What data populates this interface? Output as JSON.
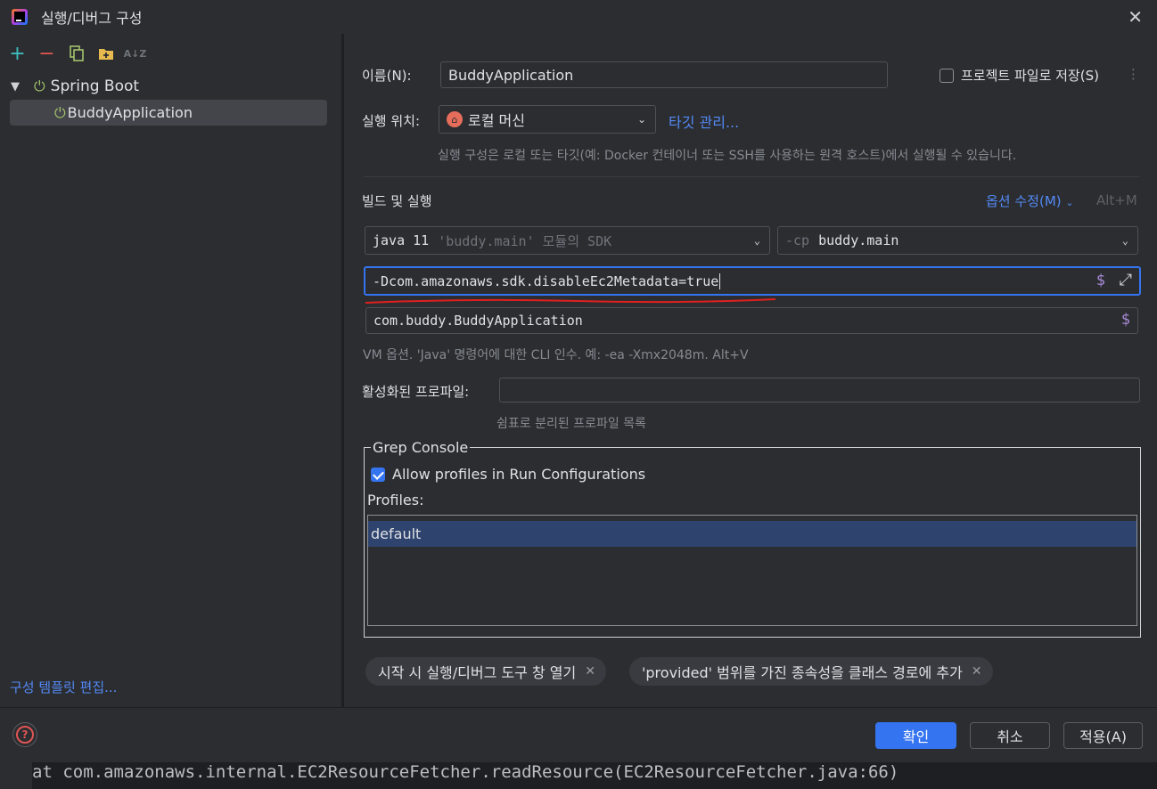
{
  "window": {
    "title": "실행/디버그 구성"
  },
  "left": {
    "tree": {
      "parent_label": "Spring Boot",
      "child_label": "BuddyApplication"
    },
    "edit_templates": "구성 템플릿 편집..."
  },
  "form": {
    "name_label": "이름(N):",
    "name_value": "BuddyApplication",
    "save_to_project": "프로젝트 파일로 저장(S)",
    "run_on_label": "실행 위치:",
    "run_on_value": "로컬 머신",
    "manage_targets": "타깃 관리...",
    "run_on_hint": "실행 구성은 로컬 또는 타깃(예: Docker 컨테이너 또는 SSH를 사용하는 원격 호스트)에서 실행될 수 있습니다.",
    "build_run_title": "빌드 및 실행",
    "modify_options": "옵션 수정(M)",
    "modify_shortcut": "Alt+M",
    "jdk_main": "java 11",
    "jdk_dim": "'buddy.main' 모듈의 SDK",
    "cp_prefix": "-cp",
    "cp_value": "buddy.main",
    "vm_options": "-Dcom.amazonaws.sdk.disableEc2Metadata=true",
    "main_class": "com.buddy.BuddyApplication",
    "vm_hint": "VM 옵션. 'Java' 명령어에 대한 CLI 인수. 예: -ea -Xmx2048m. Alt+V",
    "active_profiles_label": "활성화된 프로파일:",
    "active_profiles_value": "",
    "active_profiles_hint": "쉼표로 분리된 프로파일 목록"
  },
  "grep_console": {
    "title": "Grep Console",
    "allow_label": "Allow profiles in Run Configurations",
    "profiles_label": "Profiles:",
    "profiles": [
      "default"
    ]
  },
  "tags": [
    "시작 시 실행/디버그 도구 창 열기",
    "'provided' 범위를 가진 종속성을 클래스 경로에 추가"
  ],
  "footer": {
    "ok": "확인",
    "cancel": "취소",
    "apply": "적용(A)"
  },
  "background": {
    "line": "    at com.amazonaws.internal.EC2ResourceFetcher.readResource(EC2ResourceFetcher.java:66)"
  },
  "colors": {
    "accent": "#3574f0",
    "link": "#548af7",
    "spring": "#a4c36c",
    "underline": "#e02020"
  }
}
